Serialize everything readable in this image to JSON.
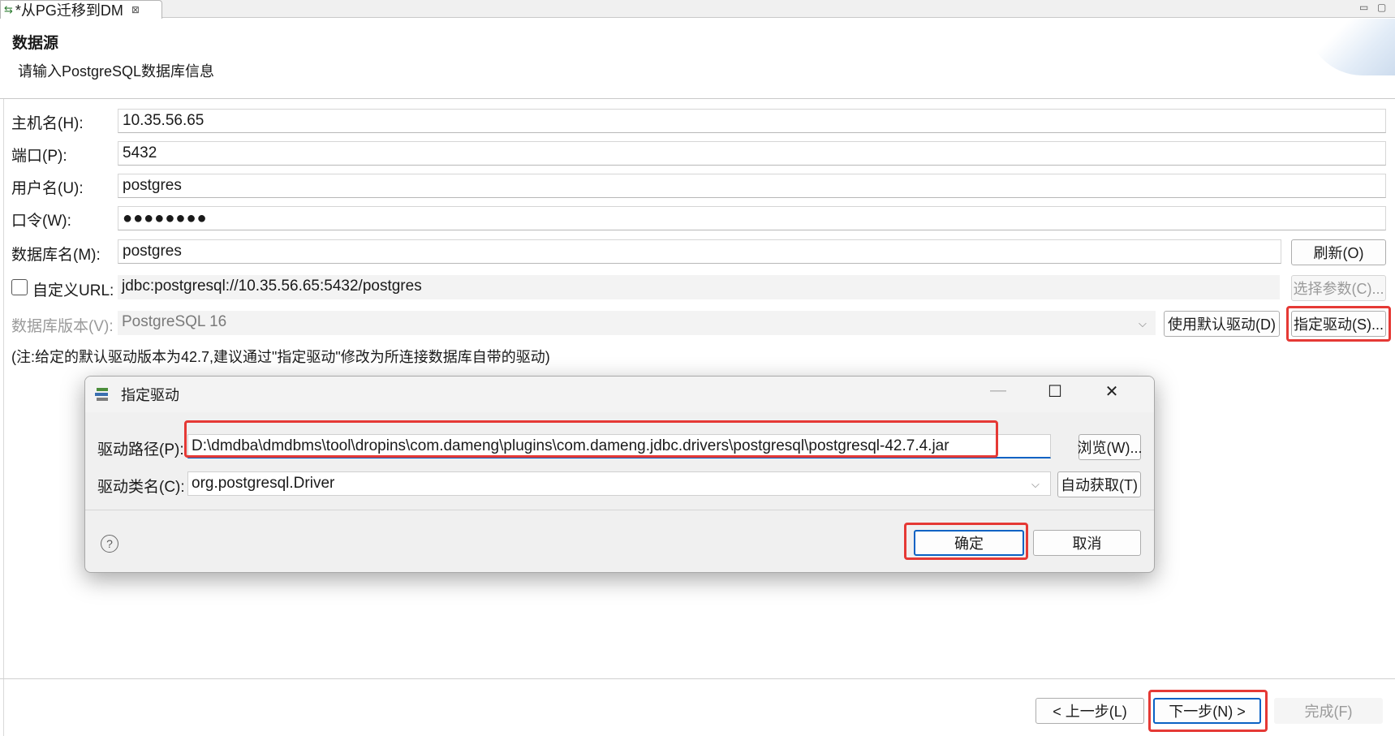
{
  "editor_tab": {
    "label": "*从PG迁移到DM",
    "close_glyph": "⊠"
  },
  "header": {
    "title": "数据源",
    "description": "请输入PostgreSQL数据库信息"
  },
  "form": {
    "host_label": "主机名(H):",
    "host_value": "10.35.56.65",
    "port_label": "端口(P):",
    "port_value": "5432",
    "user_label": "用户名(U):",
    "user_value": "postgres",
    "password_label": "口令(W):",
    "password_value": "●●●●●●●●",
    "db_label": "数据库名(M):",
    "db_value": "postgres",
    "refresh_button": "刷新(O)",
    "custom_url_label": "自定义URL:",
    "custom_url_checked": false,
    "url_value": "jdbc:postgresql://10.35.56.65:5432/postgres",
    "select_params_button": "选择参数(C)...",
    "db_version_label": "数据库版本(V):",
    "db_version_value": "PostgreSQL 16",
    "use_default_driver_button": "使用默认驱动(D)",
    "specify_driver_button": "指定驱动(S)...",
    "note": "(注:给定的默认驱动版本为42.7,建议通过\"指定驱动\"修改为所连接数据库自带的驱动)"
  },
  "dialog": {
    "title": "指定驱动",
    "minimize_glyph": "—",
    "maximize_glyph": "☐",
    "close_glyph": "✕",
    "driver_path_label": "驱动路径(P):",
    "driver_path_value": "D:\\dmdba\\dmdbms\\tool\\dropins\\com.dameng\\plugins\\com.dameng.jdbc.drivers\\postgresql\\postgresql-42.7.4.jar",
    "browse_button": "浏览(W)...",
    "driver_class_label": "驱动类名(C):",
    "driver_class_value": "org.postgresql.Driver",
    "auto_fetch_button": "自动获取(T)",
    "help_glyph": "?",
    "ok_button": "确定",
    "cancel_button": "取消"
  },
  "wizard_buttons": {
    "back": "< 上一步(L)",
    "next": "下一步(N) >",
    "finish": "完成(F)"
  },
  "colors": {
    "highlight_red": "#e53935",
    "focus_blue": "#0a62c4"
  }
}
